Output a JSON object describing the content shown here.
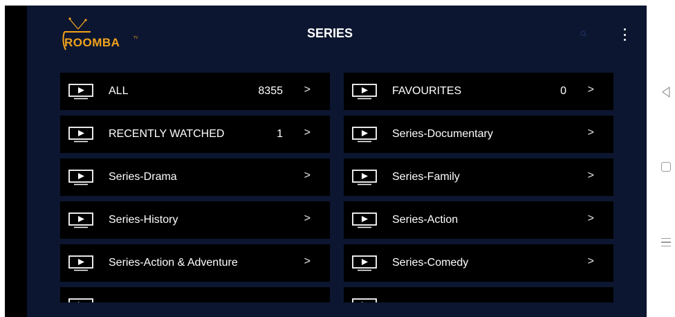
{
  "app": {
    "brand": "ROOMBA",
    "brand_tm": "TV",
    "title": "SERIES"
  },
  "icons": {
    "search": "search-icon",
    "menu": "more-vertical-icon",
    "category": "tv-play-icon",
    "arrow": "chevron-right-icon"
  },
  "colors": {
    "background": "#0c1630",
    "tile": "#000000",
    "brand": "#f2a31b",
    "text": "#ffffff"
  },
  "categories": [
    {
      "label": "ALL",
      "count": "8355",
      "arrow": ">"
    },
    {
      "label": "FAVOURITES",
      "count": "0",
      "arrow": ">"
    },
    {
      "label": "RECENTLY WATCHED",
      "count": "1",
      "arrow": ">"
    },
    {
      "label": "Series-Documentary",
      "count": "",
      "arrow": ">"
    },
    {
      "label": "Series-Drama",
      "count": "",
      "arrow": ">"
    },
    {
      "label": "Series-Family",
      "count": "",
      "arrow": ">"
    },
    {
      "label": "Series-History",
      "count": "",
      "arrow": ">"
    },
    {
      "label": "Series-Action",
      "count": "",
      "arrow": ">"
    },
    {
      "label": "Series-Action & Adventure",
      "count": "",
      "arrow": ">"
    },
    {
      "label": "Series-Comedy",
      "count": "",
      "arrow": ">"
    }
  ]
}
